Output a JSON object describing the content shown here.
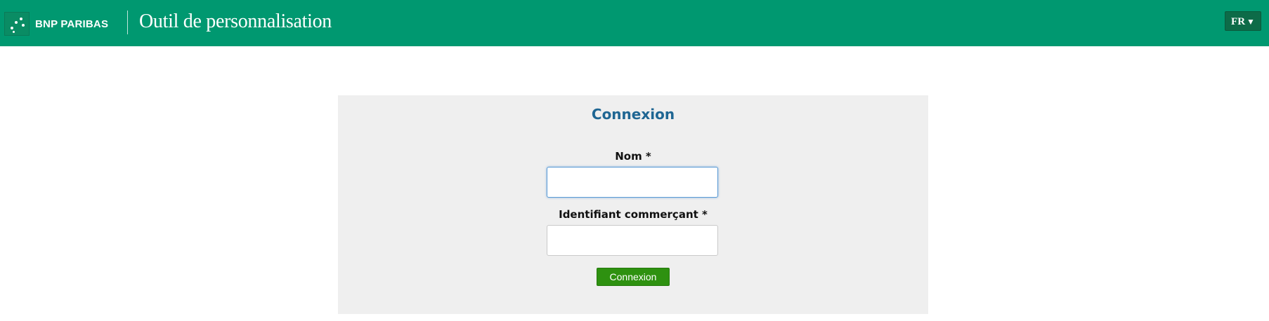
{
  "header": {
    "brand": "BNP PARIBAS",
    "title": "Outil de personnalisation",
    "language": "FR",
    "language_caret": "▼",
    "logo_icon": "bnp-stars-logo-icon",
    "background_color": "#009870"
  },
  "login": {
    "title": "Connexion",
    "name_label": "Nom *",
    "name_value": "",
    "merchant_label": "Identifiant commerçant *",
    "merchant_value": "",
    "submit_label": "Connexion",
    "title_color": "#1f6693",
    "button_color": "#2e9110",
    "panel_color": "#efefef"
  }
}
